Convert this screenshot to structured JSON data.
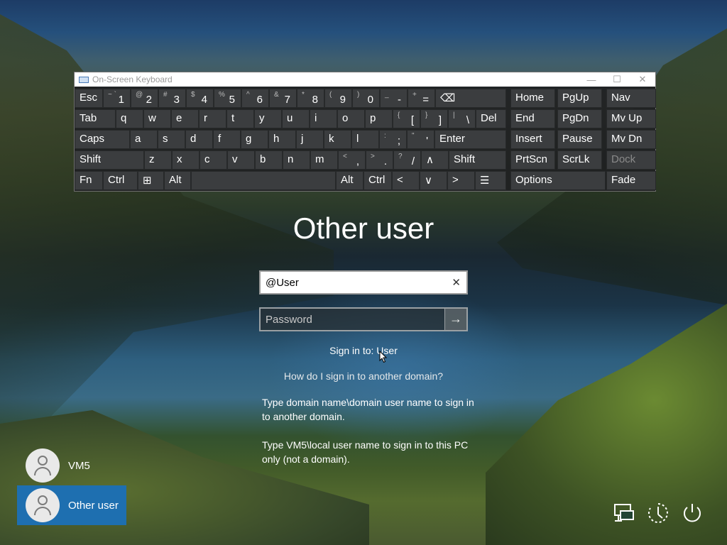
{
  "osk": {
    "title": "On-Screen Keyboard",
    "minimize": "—",
    "maximize": "☐",
    "close": "✕",
    "rows": [
      [
        {
          "id": "esc",
          "label": "Esc"
        },
        {
          "id": "tilde",
          "top": "~ `",
          "bottom": "1"
        },
        {
          "id": "k2",
          "top": "@",
          "bottom": "2"
        },
        {
          "id": "k3",
          "top": "#",
          "bottom": "3"
        },
        {
          "id": "k4",
          "top": "$",
          "bottom": "4"
        },
        {
          "id": "k5",
          "top": "%",
          "bottom": "5"
        },
        {
          "id": "k6",
          "top": "^",
          "bottom": "6"
        },
        {
          "id": "k7",
          "top": "&",
          "bottom": "7"
        },
        {
          "id": "k8",
          "top": "*",
          "bottom": "8"
        },
        {
          "id": "k9",
          "top": "(",
          "bottom": "9"
        },
        {
          "id": "k0",
          "top": ")",
          "bottom": "0"
        },
        {
          "id": "minus",
          "top": "_",
          "bottom": "-"
        },
        {
          "id": "equals",
          "top": "+",
          "bottom": "="
        },
        {
          "id": "backspace",
          "label": "⌫"
        },
        {
          "id": "home",
          "label": "Home"
        },
        {
          "id": "pgup",
          "label": "PgUp"
        },
        {
          "id": "nav",
          "label": "Nav"
        }
      ],
      [
        {
          "id": "tab",
          "label": "Tab"
        },
        {
          "id": "q",
          "label": "q"
        },
        {
          "id": "w",
          "label": "w"
        },
        {
          "id": "e",
          "label": "e"
        },
        {
          "id": "r",
          "label": "r"
        },
        {
          "id": "t",
          "label": "t"
        },
        {
          "id": "y",
          "label": "y"
        },
        {
          "id": "u",
          "label": "u"
        },
        {
          "id": "i",
          "label": "i"
        },
        {
          "id": "o",
          "label": "o"
        },
        {
          "id": "p",
          "label": "p"
        },
        {
          "id": "lbracket",
          "top": "{",
          "bottom": "["
        },
        {
          "id": "rbracket",
          "top": "}",
          "bottom": "]"
        },
        {
          "id": "backslash",
          "top": "|",
          "bottom": "\\"
        },
        {
          "id": "del",
          "label": "Del"
        },
        {
          "id": "end",
          "label": "End"
        },
        {
          "id": "pgdn",
          "label": "PgDn"
        },
        {
          "id": "mvup",
          "label": "Mv Up"
        }
      ],
      [
        {
          "id": "caps",
          "label": "Caps"
        },
        {
          "id": "a",
          "label": "a"
        },
        {
          "id": "s",
          "label": "s"
        },
        {
          "id": "d",
          "label": "d"
        },
        {
          "id": "f",
          "label": "f"
        },
        {
          "id": "g",
          "label": "g"
        },
        {
          "id": "h",
          "label": "h"
        },
        {
          "id": "j",
          "label": "j"
        },
        {
          "id": "k",
          "label": "k"
        },
        {
          "id": "l",
          "label": "l"
        },
        {
          "id": "semicolon",
          "top": ":",
          "bottom": ";"
        },
        {
          "id": "quote",
          "top": "\"",
          "bottom": "'"
        },
        {
          "id": "enter",
          "label": "Enter"
        },
        {
          "id": "insert",
          "label": "Insert"
        },
        {
          "id": "pause",
          "label": "Pause"
        },
        {
          "id": "mvdn",
          "label": "Mv Dn"
        }
      ],
      [
        {
          "id": "lshift",
          "label": "Shift"
        },
        {
          "id": "z",
          "label": "z"
        },
        {
          "id": "x",
          "label": "x"
        },
        {
          "id": "c",
          "label": "c"
        },
        {
          "id": "v",
          "label": "v"
        },
        {
          "id": "b",
          "label": "b"
        },
        {
          "id": "n",
          "label": "n"
        },
        {
          "id": "m",
          "label": "m"
        },
        {
          "id": "comma",
          "top": "<",
          "bottom": ","
        },
        {
          "id": "period",
          "top": ">",
          "bottom": "."
        },
        {
          "id": "slash",
          "top": "?",
          "bottom": "/"
        },
        {
          "id": "up",
          "label": "∧"
        },
        {
          "id": "rshift",
          "label": "Shift"
        },
        {
          "id": "prtscn",
          "label": "PrtScn"
        },
        {
          "id": "scrlk",
          "label": "ScrLk"
        },
        {
          "id": "dock",
          "label": "Dock",
          "dim": true
        }
      ],
      [
        {
          "id": "fn",
          "label": "Fn"
        },
        {
          "id": "lctrl",
          "label": "Ctrl"
        },
        {
          "id": "win",
          "label": "⊞"
        },
        {
          "id": "lalt",
          "label": "Alt"
        },
        {
          "id": "space",
          "label": ""
        },
        {
          "id": "ralt",
          "label": "Alt"
        },
        {
          "id": "rctrl",
          "label": "Ctrl"
        },
        {
          "id": "left",
          "label": "<"
        },
        {
          "id": "down",
          "label": "∨"
        },
        {
          "id": "right",
          "label": ">"
        },
        {
          "id": "menu",
          "label": "☰"
        },
        {
          "id": "options",
          "label": "Options"
        },
        {
          "id": "fade",
          "label": "Fade"
        }
      ]
    ]
  },
  "login": {
    "title": "Other user",
    "username_value": "@User",
    "clear_glyph": "✕",
    "password_placeholder": "Password",
    "submit_glyph": "→",
    "sign_in_to": "Sign in to: User",
    "domain_help_link": "How do I sign in to another domain?",
    "help_text_1": "Type domain name\\domain user name to sign in to another domain.",
    "help_text_2": "Type VM5\\local user name to sign in to this PC only (not a domain)."
  },
  "users": [
    {
      "name": "VM5",
      "active": false
    },
    {
      "name": "Other user",
      "active": true
    }
  ],
  "system_icons": [
    "network-icon",
    "ease-of-access-icon",
    "power-icon"
  ]
}
